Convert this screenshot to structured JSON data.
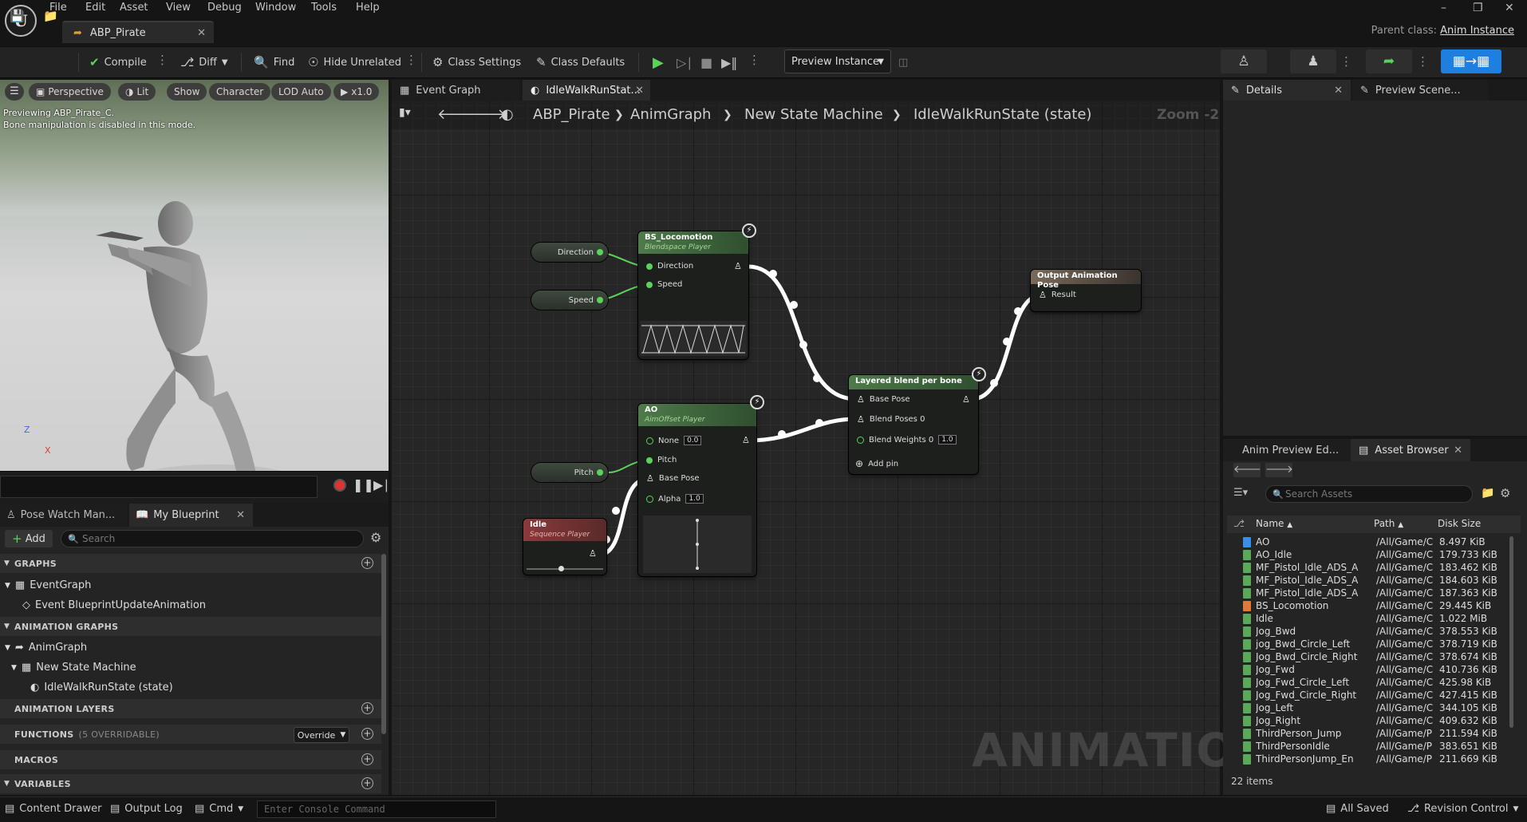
{
  "menu": [
    "File",
    "Edit",
    "Asset",
    "View",
    "Debug",
    "Window",
    "Tools",
    "Help"
  ],
  "document_tab": "ABP_Pirate",
  "parent_class_label": "Parent class:",
  "parent_class_value": "Anim Instance",
  "toolbar": {
    "compile": "Compile",
    "diff": "Diff",
    "find": "Find",
    "hide_unrelated": "Hide Unrelated",
    "class_settings": "Class Settings",
    "class_defaults": "Class Defaults",
    "preview_instance": "Preview Instance"
  },
  "viewport": {
    "perspective": "Perspective",
    "lit": "Lit",
    "show": "Show",
    "character": "Character",
    "lod": "LOD Auto",
    "speed": "x1.0",
    "info_line1": "Previewing ABP_Pirate_C.",
    "info_line2": "Bone manipulation is disabled in this mode.",
    "axis_z": "Z",
    "axis_x": "X"
  },
  "left_tabs": {
    "pose_watch": "Pose Watch Man...",
    "my_blueprint": "My Blueprint"
  },
  "my_blueprint": {
    "add": "Add",
    "search_placeholder": "Search",
    "graphs": "GRAPHS",
    "event_graph": "EventGraph",
    "event_update": "Event BlueprintUpdateAnimation",
    "animation_graphs": "ANIMATION GRAPHS",
    "anim_graph": "AnimGraph",
    "state_machine": "New State Machine",
    "state": "IdleWalkRunState (state)",
    "animation_layers": "ANIMATION LAYERS",
    "functions": "FUNCTIONS",
    "functions_count": "(5 OVERRIDABLE)",
    "override": "Override",
    "macros": "MACROS",
    "variables": "VARIABLES"
  },
  "graph_tabs": {
    "event_graph": "Event Graph",
    "state_tab": "IdleWalkRunStat..."
  },
  "breadcrumb": {
    "asset": "ABP_Pirate",
    "graph": "AnimGraph",
    "machine": "New State Machine",
    "state": "IdleWalkRunState (state)",
    "zoom": "Zoom -2"
  },
  "watermark": "ANIMATION",
  "nodes": {
    "direction_var": "Direction",
    "speed_var": "Speed",
    "pitch_var": "Pitch",
    "bs_title": "BS_Locomotion",
    "bs_sub": "Blendspace Player",
    "bs_pin_direction": "Direction",
    "bs_pin_speed": "Speed",
    "ao_title": "AO",
    "ao_sub": "AimOffset Player",
    "ao_pin_none": "None",
    "ao_none_value": "0.0",
    "ao_pin_pitch": "Pitch",
    "ao_pin_base": "Base Pose",
    "ao_pin_alpha": "Alpha",
    "ao_alpha_value": "1.0",
    "idle_title": "Idle",
    "idle_sub": "Sequence Player",
    "layered_title": "Layered blend per bone",
    "layered_base": "Base Pose",
    "layered_blend_poses": "Blend Poses 0",
    "layered_blend_weights": "Blend Weights 0",
    "layered_weight_value": "1.0",
    "layered_add_pin": "Add pin",
    "output_title": "Output Animation Pose",
    "output_result": "Result"
  },
  "details_tabs": {
    "details": "Details",
    "preview": "Preview Scene..."
  },
  "asset_browser": {
    "tab_preview_editor": "Anim Preview Ed...",
    "tab_asset_browser": "Asset Browser",
    "search_placeholder": "Search Assets",
    "col_name": "Name",
    "col_path": "Path",
    "col_size": "Disk Size",
    "rows": [
      {
        "name": "AO",
        "path": "/All/Game/C",
        "size": "8.497 KiB",
        "kind": "blue"
      },
      {
        "name": "AO_Idle",
        "path": "/All/Game/C",
        "size": "179.733 KiB",
        "kind": "green"
      },
      {
        "name": "MF_Pistol_Idle_ADS_A",
        "path": "/All/Game/C",
        "size": "183.462 KiB",
        "kind": "green"
      },
      {
        "name": "MF_Pistol_Idle_ADS_A",
        "path": "/All/Game/C",
        "size": "184.603 KiB",
        "kind": "green"
      },
      {
        "name": "MF_Pistol_Idle_ADS_A",
        "path": "/All/Game/C",
        "size": "187.363 KiB",
        "kind": "green"
      },
      {
        "name": "BS_Locomotion",
        "path": "/All/Game/C",
        "size": "29.445 KiB",
        "kind": "orange"
      },
      {
        "name": "Idle",
        "path": "/All/Game/C",
        "size": "1.022 MiB",
        "kind": "green"
      },
      {
        "name": "Jog_Bwd",
        "path": "/All/Game/C",
        "size": "378.553 KiB",
        "kind": "green"
      },
      {
        "name": "jog_Bwd_Circle_Left",
        "path": "/All/Game/C",
        "size": "378.719 KiB",
        "kind": "green"
      },
      {
        "name": "Jog_Bwd_Circle_Right",
        "path": "/All/Game/C",
        "size": "378.674 KiB",
        "kind": "green"
      },
      {
        "name": "Jog_Fwd",
        "path": "/All/Game/C",
        "size": "410.736 KiB",
        "kind": "green"
      },
      {
        "name": "Jog_Fwd_Circle_Left",
        "path": "/All/Game/C",
        "size": "425.98 KiB",
        "kind": "green"
      },
      {
        "name": "Jog_Fwd_Circle_Right",
        "path": "/All/Game/C",
        "size": "427.415 KiB",
        "kind": "green"
      },
      {
        "name": "Jog_Left",
        "path": "/All/Game/C",
        "size": "344.105 KiB",
        "kind": "green"
      },
      {
        "name": "Jog_Right",
        "path": "/All/Game/C",
        "size": "409.632 KiB",
        "kind": "green"
      },
      {
        "name": "ThirdPerson_Jump",
        "path": "/All/Game/P",
        "size": "211.594 KiB",
        "kind": "green"
      },
      {
        "name": "ThirdPersonIdle",
        "path": "/All/Game/P",
        "size": "383.651 KiB",
        "kind": "green"
      },
      {
        "name": "ThirdPersonJump_En",
        "path": "/All/Game/P",
        "size": "211.669 KiB",
        "kind": "green"
      }
    ],
    "count": "22 items"
  },
  "statusbar": {
    "content_drawer": "Content Drawer",
    "output_log": "Output Log",
    "cmd": "Cmd",
    "console_placeholder": "Enter Console Command",
    "all_saved": "All Saved",
    "revision_control": "Revision Control"
  },
  "colors": {
    "accent": "#1f7fe0",
    "exec_green": "#5bd35b",
    "node_header_green": "#4f7a4a",
    "node_header_red": "#8a3a3a"
  }
}
